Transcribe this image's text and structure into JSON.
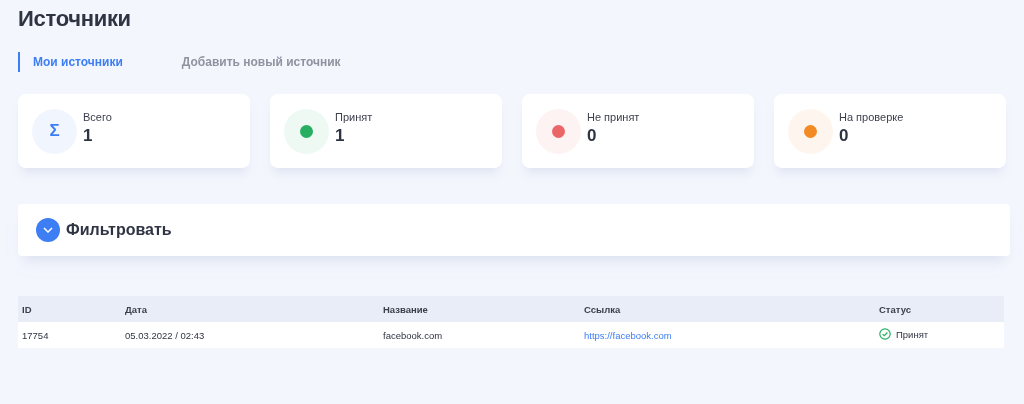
{
  "page_title": "Источники",
  "tabs": [
    {
      "label": "Мои источники",
      "selected": true
    },
    {
      "label": "Добавить новый источник",
      "selected": false
    }
  ],
  "stats": [
    {
      "kind": "sum",
      "icon": "Σ",
      "label": "Всего",
      "value": "1",
      "color": "#3d7ef5"
    },
    {
      "kind": "dot",
      "label": "Принят",
      "value": "1",
      "color": "#27ae60"
    },
    {
      "kind": "dot",
      "label": "Не принят",
      "value": "0",
      "color": "#eb6767"
    },
    {
      "kind": "dot",
      "label": "На проверке",
      "value": "0",
      "color": "#f28b24"
    }
  ],
  "filter": {
    "label": "Фильтровать",
    "expanded": false
  },
  "table": {
    "columns": [
      "ID",
      "Дата",
      "Название",
      "Ссылка",
      "Статус"
    ],
    "rows": [
      {
        "id": "17754",
        "date": "05.03.2022 / 02:43",
        "name": "facebook.com",
        "link": "https://facebook.com",
        "status": "Принят",
        "accepted": true
      }
    ]
  }
}
